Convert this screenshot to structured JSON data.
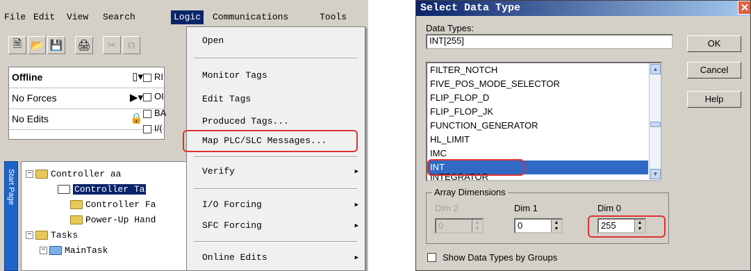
{
  "rslogix": {
    "menu": [
      {
        "label": "File"
      },
      {
        "label": "Edit"
      },
      {
        "label": "View"
      },
      {
        "label": "Search"
      },
      {
        "label": "Logic"
      },
      {
        "label": "Communications"
      },
      {
        "label": "Tools"
      }
    ],
    "status": {
      "mode": "Offline",
      "forces": "No Forces",
      "edits": "No Edits"
    },
    "checkboxes": [
      "RI",
      "OI",
      "BA",
      "I/("
    ],
    "start_page_tab": "Start Page",
    "tree": [
      {
        "label": "Controller aa"
      },
      {
        "label": "Controller Ta"
      },
      {
        "label": "Controller Fa"
      },
      {
        "label": "Power-Up Hand"
      },
      {
        "label": "Tasks"
      },
      {
        "label": "MainTask"
      }
    ],
    "logic_menu": {
      "items": [
        {
          "label": "Open"
        },
        {
          "label": "Monitor Tags"
        },
        {
          "label": "Edit Tags"
        },
        {
          "label": "Produced Tags..."
        },
        {
          "label": "Map PLC/SLC Messages..."
        },
        {
          "label": "Verify"
        },
        {
          "label": "I/O Forcing"
        },
        {
          "label": "SFC Forcing"
        },
        {
          "label": "Online Edits"
        }
      ]
    }
  },
  "dialog": {
    "title": "Select Data Type",
    "data_types_label": "Data Types:",
    "data_types_value": "INT[255]",
    "buttons": {
      "ok": "OK",
      "cancel": "Cancel",
      "help": "Help"
    },
    "list": [
      "FILTER_NOTCH",
      "FIVE_POS_MODE_SELECTOR",
      "FLIP_FLOP_D",
      "FLIP_FLOP_JK",
      "FUNCTION_GENERATOR",
      "HL_LIMIT",
      "IMC",
      "INT",
      "INTEGRATOR"
    ],
    "selected": "INT",
    "array": {
      "title": "Array Dimensions",
      "dim2_label": "Dim 2",
      "dim2_value": "0",
      "dim1_label": "Dim 1",
      "dim1_value": "0",
      "dim0_label": "Dim 0",
      "dim0_value": "255"
    },
    "show_groups_label": "Show Data Types by Groups"
  },
  "colors": {
    "highlight": "#e03030",
    "selection": "#316ac5",
    "menu_active": "#0a246a"
  }
}
